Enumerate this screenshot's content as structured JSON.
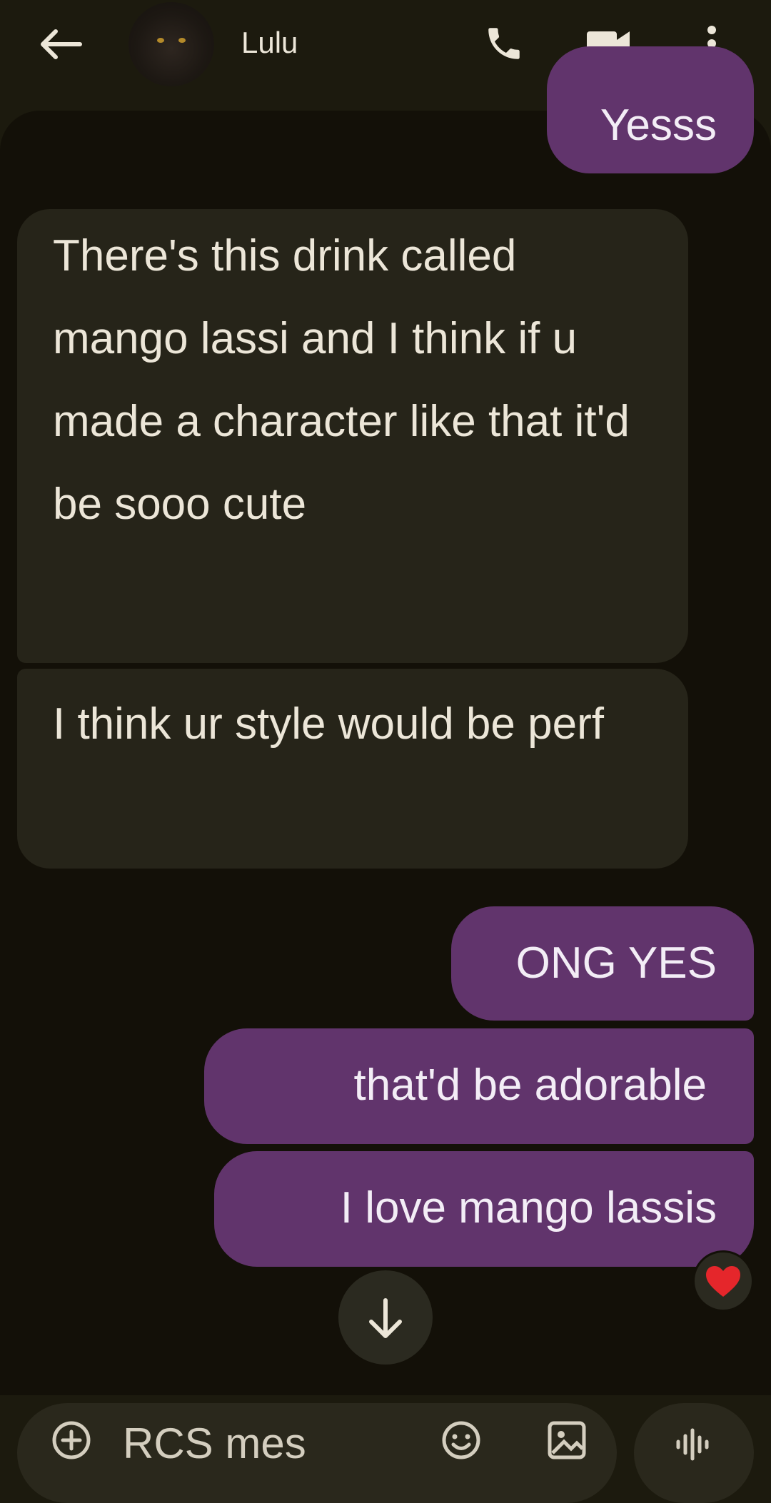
{
  "header": {
    "contact_name": "Lulu",
    "back_icon": "arrow-left-icon",
    "call_icon": "phone-icon",
    "video_icon": "video-camera-icon",
    "menu_icon": "more-vert-icon"
  },
  "messages": [
    {
      "direction": "outgoing",
      "text": "Yesss"
    },
    {
      "direction": "incoming",
      "text": "There's this drink called mango lassi and I think if u made a character like that it'd be sooo cute"
    },
    {
      "direction": "incoming",
      "text": "I think ur style would be perf"
    },
    {
      "direction": "outgoing",
      "text": "ONG YES"
    },
    {
      "direction": "outgoing",
      "text": "that'd be adorable"
    },
    {
      "direction": "outgoing",
      "text": "I love mango lassis",
      "reaction": "❤️"
    }
  ],
  "scroll_down_icon": "arrow-down-icon",
  "composer": {
    "placeholder": "RCS mes",
    "add_icon": "add-circle-icon",
    "emoji_icon": "emoji-icon",
    "gallery_icon": "image-icon",
    "voice_icon": "voice-waveform-icon"
  },
  "colors": {
    "background": "#1c1a0e",
    "chat_background": "#131008",
    "incoming_bubble": "#262419",
    "outgoing_bubble": "#61346c",
    "text": "#ece6d8"
  }
}
